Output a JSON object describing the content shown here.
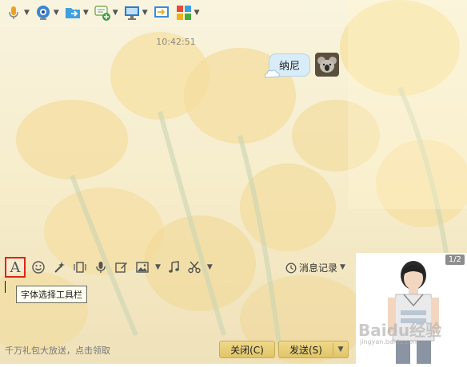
{
  "colors": {
    "accent_red": "#e0231b",
    "bubble_bg": "#d9ecf9",
    "button_gold": "#e8cf7a"
  },
  "toolbar_top": {
    "items": [
      {
        "icon": "microphone-icon"
      },
      {
        "icon": "webcam-icon"
      },
      {
        "icon": "send-file-icon"
      },
      {
        "icon": "add-chat-icon"
      },
      {
        "icon": "remote-desktop-icon"
      },
      {
        "icon": "screen-share-icon"
      },
      {
        "icon": "apps-icon"
      }
    ]
  },
  "chat": {
    "timestamp": "10:42:51",
    "messages": [
      {
        "text": "纳尼"
      }
    ]
  },
  "input_toolbar": {
    "font_label": "A",
    "font_tooltip": "字体选择工具栏",
    "history_label": "消息记录"
  },
  "footer": {
    "promo_text": "千万礼包大放送，点击领取",
    "close_label": "关闭(C)",
    "send_label": "发送(S)"
  },
  "show_panel": {
    "page_indicator": "1/2",
    "watermark": "Baidu经验",
    "watermark_sub": "jingyan.baidu.com"
  }
}
